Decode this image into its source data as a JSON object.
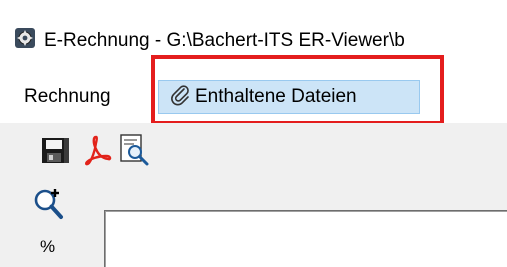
{
  "window": {
    "title": "E-Rechnung - G:\\Bachert-ITS ER-Viewer\\b",
    "app_icon": "app-settings-icon"
  },
  "menu": {
    "items": [
      {
        "label": "Rechnung"
      },
      {
        "label": "Enthaltene Dateien",
        "icon": "paperclip-icon",
        "state": "hover"
      }
    ],
    "highlight_color": "#e41d1d",
    "hover_color": "#cce4f7"
  },
  "toolbar": {
    "buttons": [
      {
        "icon": "save-icon"
      },
      {
        "icon": "pdf-icon"
      },
      {
        "icon": "preview-search-icon"
      }
    ]
  },
  "side_toolbar": {
    "zoom_icon": "zoom-in-icon",
    "zoom_label": "%"
  }
}
